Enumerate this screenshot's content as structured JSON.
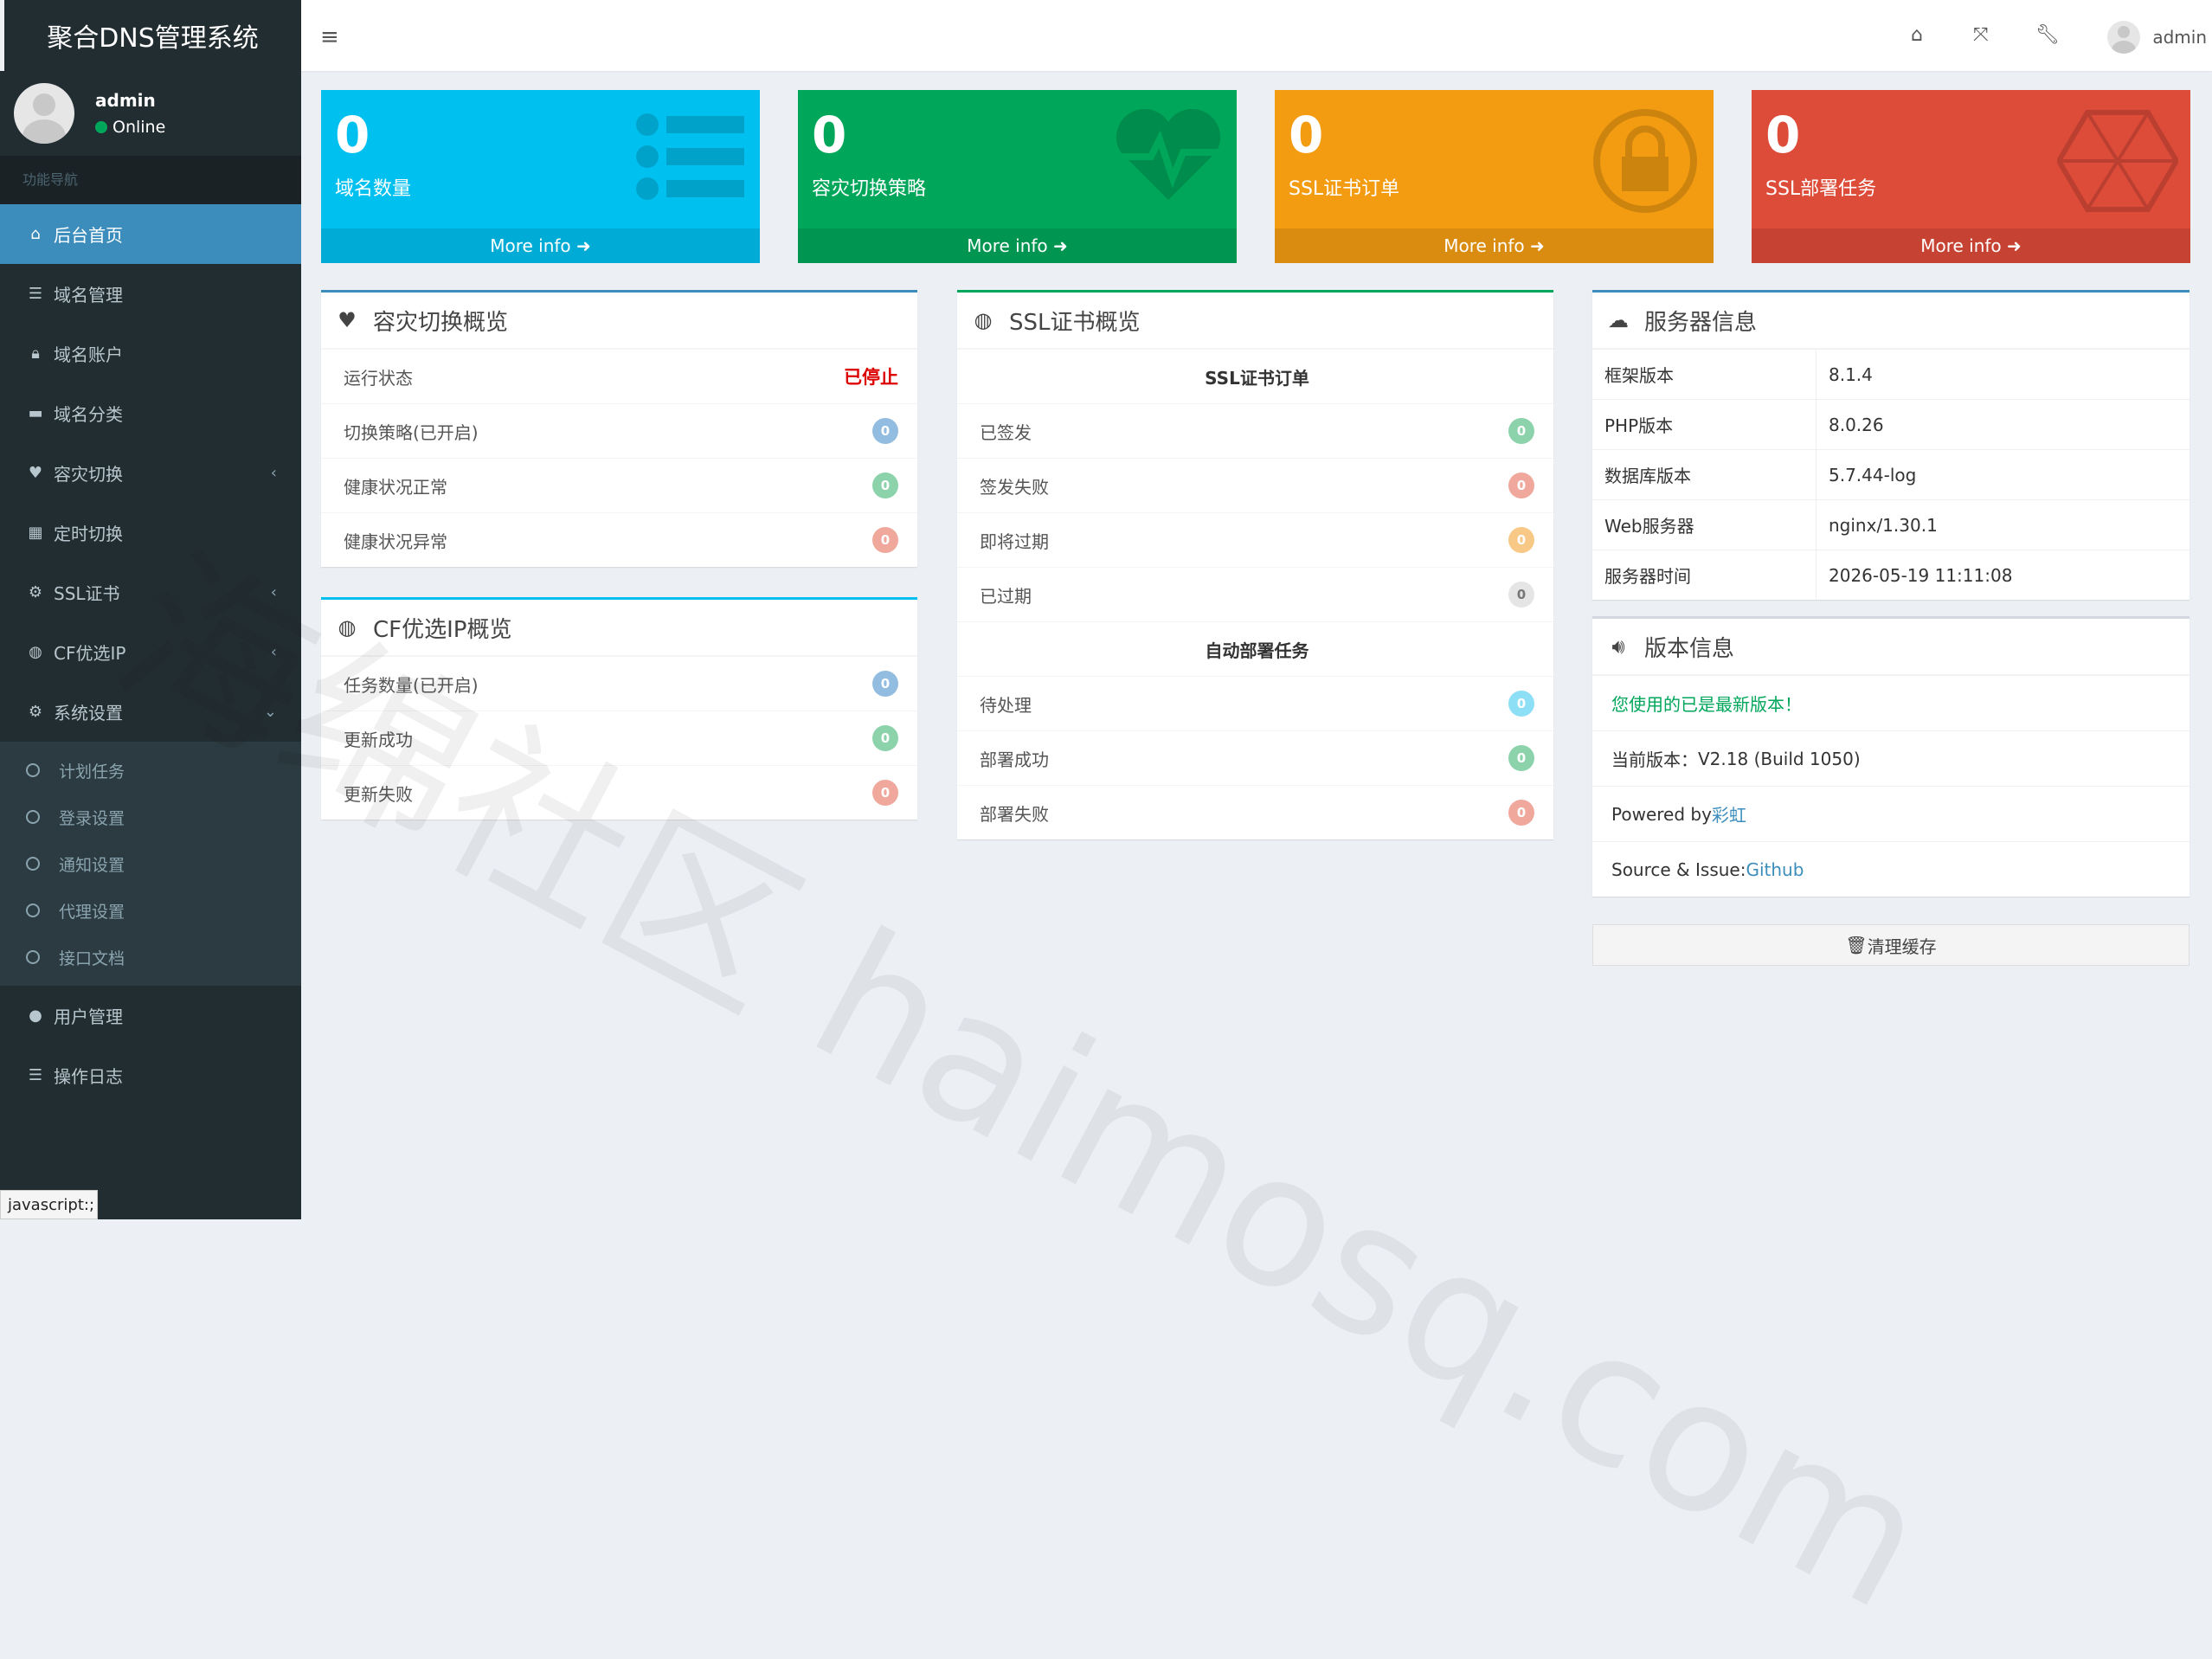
{
  "app": {
    "title": "聚合DNS管理系统"
  },
  "user": {
    "name": "admin",
    "status": "Online"
  },
  "sidebar": {
    "header": "功能导航",
    "items": [
      {
        "label": "后台首页",
        "icon": "home-icon",
        "active": true
      },
      {
        "label": "域名管理",
        "icon": "list-icon"
      },
      {
        "label": "域名账户",
        "icon": "lock-icon"
      },
      {
        "label": "域名分类",
        "icon": "folder-icon"
      },
      {
        "label": "容灾切换",
        "icon": "heartbeat-icon",
        "chevron": "‹"
      },
      {
        "label": "定时切换",
        "icon": "calendar-icon"
      },
      {
        "label": "SSL证书",
        "icon": "certificate-icon",
        "chevron": "‹"
      },
      {
        "label": "CF优选IP",
        "icon": "globe-icon",
        "chevron": "‹"
      },
      {
        "label": "系统设置",
        "icon": "cogs-icon",
        "chevron": "⌄"
      }
    ],
    "subitems": [
      "计划任务",
      "登录设置",
      "通知设置",
      "代理设置",
      "接口文档"
    ],
    "bottom_items": [
      {
        "label": "用户管理",
        "icon": "user-icon"
      },
      {
        "label": "操作日志",
        "icon": "list-icon"
      }
    ]
  },
  "status_bar": "javascript:;",
  "topbar": {
    "username": "admin"
  },
  "stats": [
    {
      "value": "0",
      "label": "域名数量",
      "more": "More info",
      "color": "#00c0ef",
      "icon": "list-icon"
    },
    {
      "value": "0",
      "label": "容灾切换策略",
      "more": "More info",
      "color": "#00a65a",
      "icon": "heartbeat-icon"
    },
    {
      "value": "0",
      "label": "SSL证书订单",
      "more": "More info",
      "color": "#f39c12",
      "icon": "lock-icon"
    },
    {
      "value": "0",
      "label": "SSL部署任务",
      "more": "More info",
      "color": "#dd4b39",
      "icon": "hexagon-icon"
    }
  ],
  "failover": {
    "title": "容灾切换概览",
    "rows": [
      {
        "label": "运行状态",
        "value": "已停止"
      },
      {
        "label": "切换策略(已开启)",
        "value": "0"
      },
      {
        "label": "健康状况正常",
        "value": "0"
      },
      {
        "label": "健康状况异常",
        "value": "0"
      }
    ]
  },
  "cfip": {
    "title": "CF优选IP概览",
    "rows": [
      {
        "label": "任务数量(已开启)",
        "value": "0"
      },
      {
        "label": "更新成功",
        "value": "0"
      },
      {
        "label": "更新失败",
        "value": "0"
      }
    ]
  },
  "ssl": {
    "title": "SSL证书概览",
    "section1": "SSL证书订单",
    "rows1": [
      {
        "label": "已签发",
        "value": "0"
      },
      {
        "label": "签发失败",
        "value": "0"
      },
      {
        "label": "即将过期",
        "value": "0"
      },
      {
        "label": "已过期",
        "value": "0"
      }
    ],
    "section2": "自动部署任务",
    "rows2": [
      {
        "label": "待处理",
        "value": "0"
      },
      {
        "label": "部署成功",
        "value": "0"
      },
      {
        "label": "部署失败",
        "value": "0"
      }
    ]
  },
  "server": {
    "title": "服务器信息",
    "rows": [
      {
        "k": "框架版本",
        "v": "8.1.4"
      },
      {
        "k": "PHP版本",
        "v": "8.0.26"
      },
      {
        "k": "数据库版本",
        "v": "5.7.44-log"
      },
      {
        "k": "Web服务器",
        "v": "nginx/1.30.1"
      },
      {
        "k": "服务器时间",
        "v": "2026-05-19 11:11:08"
      }
    ]
  },
  "version": {
    "title": "版本信息",
    "latest": "您使用的已是最新版本！",
    "current_label": "当前版本：",
    "current": "V2.18 (Build 1050)",
    "powered_label": "Powered by ",
    "powered_link": "彩虹",
    "source_label": "Source & Issue: ",
    "source_link": "Github"
  },
  "clear_cache": "清理缓存",
  "watermark": "海绵社区 haimosq.com"
}
